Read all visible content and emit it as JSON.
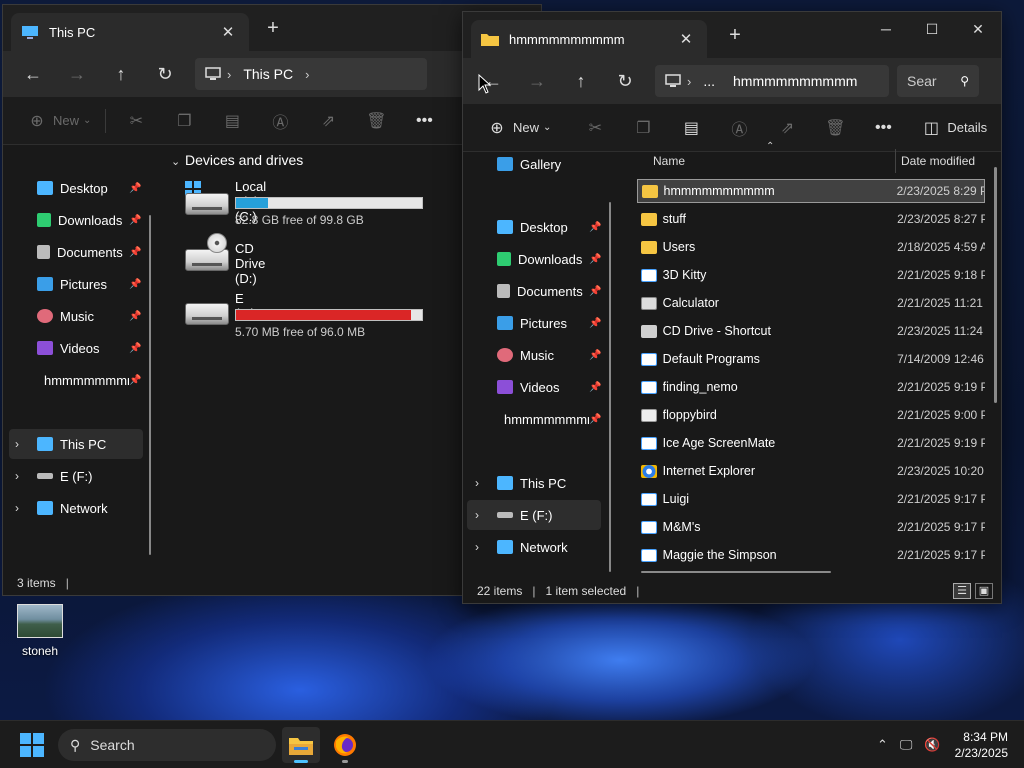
{
  "desktop": {
    "icon_label": "stoneh"
  },
  "window1": {
    "tab_title": "This PC",
    "address": [
      "This PC"
    ],
    "toolbar": {
      "new_label": "New"
    },
    "nav_pinned": [
      {
        "label": "Desktop",
        "icon": "desktop-icon"
      },
      {
        "label": "Downloads",
        "icon": "download-icon"
      },
      {
        "label": "Documents",
        "icon": "document-icon"
      },
      {
        "label": "Pictures",
        "icon": "pictures-icon"
      },
      {
        "label": "Music",
        "icon": "music-icon"
      },
      {
        "label": "Videos",
        "icon": "videos-icon"
      },
      {
        "label": "hmmmmmmmmmm",
        "icon": "folder-icon"
      }
    ],
    "nav_tree": [
      {
        "label": "This PC",
        "icon": "computer-icon"
      },
      {
        "label": "E (F:)",
        "icon": "drive-icon"
      },
      {
        "label": "Network",
        "icon": "network-icon"
      }
    ],
    "section_title": "Devices and drives",
    "drives": [
      {
        "name": "Local Disk (C:)",
        "free_text": "82.8 GB free of 99.8 GB",
        "used_fraction": 0.17,
        "bar_color": "#26a0da"
      },
      {
        "name": "CD Drive (D:)",
        "free_text": "",
        "used_fraction": null,
        "bar_color": ""
      },
      {
        "name": "E (F:)",
        "free_text": "5.70 MB free of 96.0 MB",
        "used_fraction": 0.94,
        "bar_color": "#da2626"
      }
    ],
    "status": {
      "count": "3 items"
    }
  },
  "window2": {
    "tab_title": "hmmmmmmmmmm",
    "address": [
      "...",
      "hmmmmmmmmmm"
    ],
    "search_placeholder": "Sear",
    "toolbar": {
      "new_label": "New",
      "details_label": "Details"
    },
    "nav_top": {
      "label": "Gallery",
      "icon": "gallery-icon"
    },
    "nav_pinned": [
      {
        "label": "Desktop",
        "icon": "desktop-icon"
      },
      {
        "label": "Downloads",
        "icon": "download-icon"
      },
      {
        "label": "Documents",
        "icon": "document-icon"
      },
      {
        "label": "Pictures",
        "icon": "pictures-icon"
      },
      {
        "label": "Music",
        "icon": "music-icon"
      },
      {
        "label": "Videos",
        "icon": "videos-icon"
      },
      {
        "label": "hmmmmmmmmmm",
        "icon": "folder-icon"
      }
    ],
    "nav_tree": [
      {
        "label": "This PC",
        "icon": "computer-icon"
      },
      {
        "label": "E (F:)",
        "icon": "drive-icon"
      },
      {
        "label": "Network",
        "icon": "network-icon"
      }
    ],
    "columns": {
      "name": "Name",
      "date": "Date modified"
    },
    "files": [
      {
        "name": "hmmmmmmmmmm",
        "date": "2/23/2025 8:29 P",
        "type": "folder"
      },
      {
        "name": "stuff",
        "date": "2/23/2025 8:27 P",
        "type": "folder"
      },
      {
        "name": "Users",
        "date": "2/18/2025 4:59 A",
        "type": "folder"
      },
      {
        "name": "3D Kitty",
        "date": "2/21/2025 9:18 P",
        "type": "app"
      },
      {
        "name": "Calculator",
        "date": "2/21/2025 11:21",
        "type": "calc"
      },
      {
        "name": "CD Drive - Shortcut",
        "date": "2/23/2025 11:24",
        "type": "shortcut"
      },
      {
        "name": "Default Programs",
        "date": "7/14/2009 12:46",
        "type": "app"
      },
      {
        "name": "finding_nemo",
        "date": "2/21/2025 9:19 P",
        "type": "app"
      },
      {
        "name": "floppybird",
        "date": "2/21/2025 9:00 P",
        "type": "doc"
      },
      {
        "name": "Ice Age ScreenMate",
        "date": "2/21/2025 9:19 P",
        "type": "app"
      },
      {
        "name": "Internet Explorer",
        "date": "2/23/2025 10:20",
        "type": "ie"
      },
      {
        "name": "Luigi",
        "date": "2/21/2025 9:17 P",
        "type": "app"
      },
      {
        "name": "M&M's",
        "date": "2/21/2025 9:17 P",
        "type": "app"
      },
      {
        "name": "Maggie the Simpson",
        "date": "2/21/2025 9:17 P",
        "type": "app"
      }
    ],
    "status": {
      "count": "22 items",
      "selected": "1 item selected"
    }
  },
  "taskbar": {
    "search_label": "Search",
    "time": "8:34 PM",
    "date": "2/23/2025"
  },
  "colors": {
    "accent": "#4cc2ff",
    "folder": "#f5c542",
    "c_drive_bar": "#26a0da",
    "f_drive_bar": "#da2626"
  }
}
